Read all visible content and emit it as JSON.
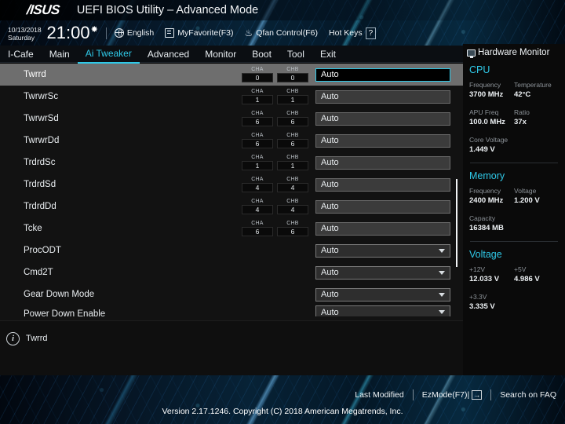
{
  "titlebar": {
    "logo": "/ISUS",
    "title": "UEFI BIOS Utility – Advanced Mode"
  },
  "utilbar": {
    "date": "10/13/2018",
    "day": "Saturday",
    "time": "21:00",
    "gear_icon": "gear-icon",
    "language": "English",
    "myfavorite": "MyFavorite(F3)",
    "qfan": "Qfan Control(F6)",
    "hotkeys_label": "Hot Keys",
    "hotkeys_badge": "?"
  },
  "menu": {
    "items": [
      {
        "label": "I-Cafe",
        "active": false
      },
      {
        "label": "Main",
        "active": false
      },
      {
        "label": "Ai Tweaker",
        "active": true
      },
      {
        "label": "Advanced",
        "active": false
      },
      {
        "label": "Monitor",
        "active": false
      },
      {
        "label": "Boot",
        "active": false
      },
      {
        "label": "Tool",
        "active": false
      },
      {
        "label": "Exit",
        "active": false
      }
    ]
  },
  "settings": {
    "ch_a_label": "CHA",
    "ch_b_label": "CHB",
    "rows": [
      {
        "label": "Twrrd",
        "cha": "0",
        "chb": "0",
        "value": "Auto",
        "type": "input",
        "selected": true,
        "clipped": false
      },
      {
        "label": "TwrwrSc",
        "cha": "1",
        "chb": "1",
        "value": "Auto",
        "type": "input",
        "selected": false,
        "clipped": false
      },
      {
        "label": "TwrwrSd",
        "cha": "6",
        "chb": "6",
        "value": "Auto",
        "type": "input",
        "selected": false,
        "clipped": false
      },
      {
        "label": "TwrwrDd",
        "cha": "6",
        "chb": "6",
        "value": "Auto",
        "type": "input",
        "selected": false,
        "clipped": false
      },
      {
        "label": "TrdrdSc",
        "cha": "1",
        "chb": "1",
        "value": "Auto",
        "type": "input",
        "selected": false,
        "clipped": false
      },
      {
        "label": "TrdrdSd",
        "cha": "4",
        "chb": "4",
        "value": "Auto",
        "type": "input",
        "selected": false,
        "clipped": false
      },
      {
        "label": "TrdrdDd",
        "cha": "4",
        "chb": "4",
        "value": "Auto",
        "type": "input",
        "selected": false,
        "clipped": false
      },
      {
        "label": "Tcke",
        "cha": "6",
        "chb": "6",
        "value": "Auto",
        "type": "input",
        "selected": false,
        "clipped": false
      },
      {
        "label": "ProcODT",
        "cha": "",
        "chb": "",
        "value": "Auto",
        "type": "dropdown",
        "selected": false,
        "clipped": false
      },
      {
        "label": "Cmd2T",
        "cha": "",
        "chb": "",
        "value": "Auto",
        "type": "dropdown",
        "selected": false,
        "clipped": false
      },
      {
        "label": "Gear Down Mode",
        "cha": "",
        "chb": "",
        "value": "Auto",
        "type": "dropdown",
        "selected": false,
        "clipped": false
      },
      {
        "label": "Power Down Enable",
        "cha": "",
        "chb": "",
        "value": "Auto",
        "type": "dropdown",
        "selected": false,
        "clipped": true
      }
    ]
  },
  "help": {
    "info_icon": "info-icon",
    "text": "Twrrd"
  },
  "hardware_monitor": {
    "title": "Hardware Monitor",
    "sections": [
      {
        "name": "CPU",
        "rows": [
          [
            {
              "key": "Frequency",
              "value": "3700 MHz"
            },
            {
              "key": "Temperature",
              "value": "42°C"
            }
          ],
          [
            {
              "key": "APU Freq",
              "value": "100.0 MHz"
            },
            {
              "key": "Ratio",
              "value": "37x"
            }
          ],
          [
            {
              "key": "Core Voltage",
              "value": "1.449 V"
            }
          ]
        ]
      },
      {
        "name": "Memory",
        "rows": [
          [
            {
              "key": "Frequency",
              "value": "2400 MHz"
            },
            {
              "key": "Voltage",
              "value": "1.200 V"
            }
          ],
          [
            {
              "key": "Capacity",
              "value": "16384 MB"
            }
          ]
        ]
      },
      {
        "name": "Voltage",
        "rows": [
          [
            {
              "key": "+12V",
              "value": "12.033 V"
            },
            {
              "key": "+5V",
              "value": "4.986 V"
            }
          ],
          [
            {
              "key": "+3.3V",
              "value": "3.335 V"
            }
          ]
        ]
      }
    ]
  },
  "bottombar": {
    "last_modified": "Last Modified",
    "ezmode": "EzMode(F7)|",
    "ezmode_arrow": "→",
    "search_faq": "Search on FAQ"
  },
  "version": "Version 2.17.1246. Copyright (C) 2018 American Megatrends, Inc.",
  "colors": {
    "accent": "#2fc9e8",
    "selected_row": "#6e6e6e",
    "panel_bg": "#121212"
  }
}
